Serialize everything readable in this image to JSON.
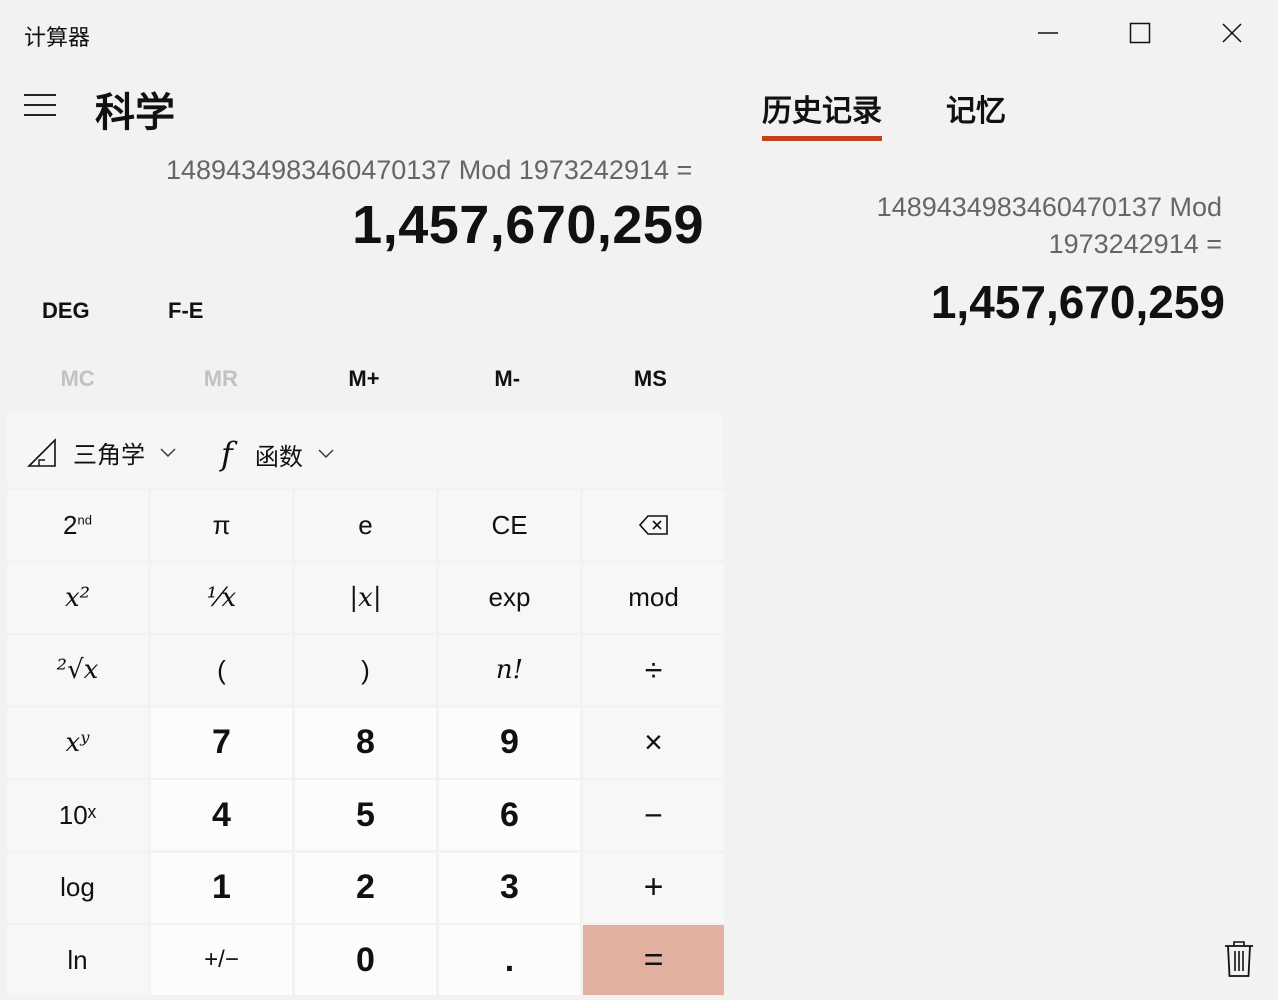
{
  "window": {
    "title": "计算器",
    "minimize_icon": "minimize-icon",
    "maximize_icon": "maximize-icon",
    "close_icon": "close-icon"
  },
  "header": {
    "mode": "科学"
  },
  "display": {
    "expression": "1489434983460470137 Mod 1973242914 =",
    "result": "1,457,670,259"
  },
  "toggles": {
    "angle": "DEG",
    "fe": "F-E"
  },
  "memory": [
    "MC",
    "MR",
    "M+",
    "M-",
    "MS"
  ],
  "funcbar": {
    "trig": "三角学",
    "func": "函数"
  },
  "keys": [
    [
      "2nd",
      "π",
      "e",
      "CE",
      "⌫"
    ],
    [
      "x²",
      "¹⁄x",
      "|x|",
      "exp",
      "mod"
    ],
    [
      "²√x",
      "(",
      ")",
      "n!",
      "÷"
    ],
    [
      "xʸ",
      "7",
      "8",
      "9",
      "×"
    ],
    [
      "10ˣ",
      "4",
      "5",
      "6",
      "−"
    ],
    [
      "log",
      "1",
      "2",
      "3",
      "+"
    ],
    [
      "ln",
      "+/−",
      "0",
      ".",
      "="
    ]
  ],
  "side": {
    "tabs": [
      "历史记录",
      "记忆"
    ],
    "history": {
      "expr_line1": "1489434983460470137   Mod",
      "expr_line2": "1973242914 =",
      "result": "1,457,670,259"
    },
    "trash_icon": "trash-icon"
  },
  "colors": {
    "accent": "#c4421a",
    "equals": "#e1b09f",
    "background": "#f2f2f2"
  }
}
